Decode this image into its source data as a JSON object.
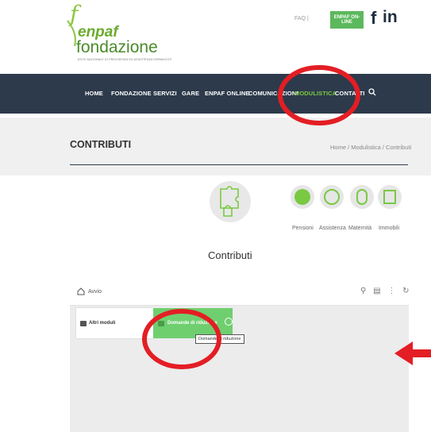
{
  "header": {
    "logo": {
      "letter": "f",
      "brand": "enpaf",
      "name": "fondazione",
      "tagline": "ENTE NAZIONALE DI PREVIDENZA ED ASSISTENZA FARMACISTI"
    },
    "faq_label": "FAQ |",
    "enpaf_online_label": "ENPAF ON-LINE",
    "facebook": "f",
    "linkedin": "in"
  },
  "nav": {
    "items": [
      "HOME",
      "FONDAZIONE",
      "SERVIZI",
      "GARE",
      "ENPAF ONLINE",
      "COMUNICAZIONI",
      "MODULISTICA",
      "CONTATTI"
    ],
    "active": "MODULISTICA",
    "active_color": "#7ac943"
  },
  "page": {
    "title": "CONTRIBUTI",
    "breadcrumb": "Home / Modulistica / Contributi"
  },
  "categories": {
    "main": "Contributi",
    "others": [
      "Pensioni",
      "Assistenza",
      "Maternità",
      "Immobili"
    ]
  },
  "file_manager": {
    "root": "Avvio",
    "folders": [
      "Altri moduli",
      "Domande di riduzione"
    ],
    "tooltip": "Domande di riduzione"
  },
  "colors": {
    "nav_bg": "#2d3a4b",
    "green": "#5cb85c",
    "annotation_red": "#e31e24"
  }
}
